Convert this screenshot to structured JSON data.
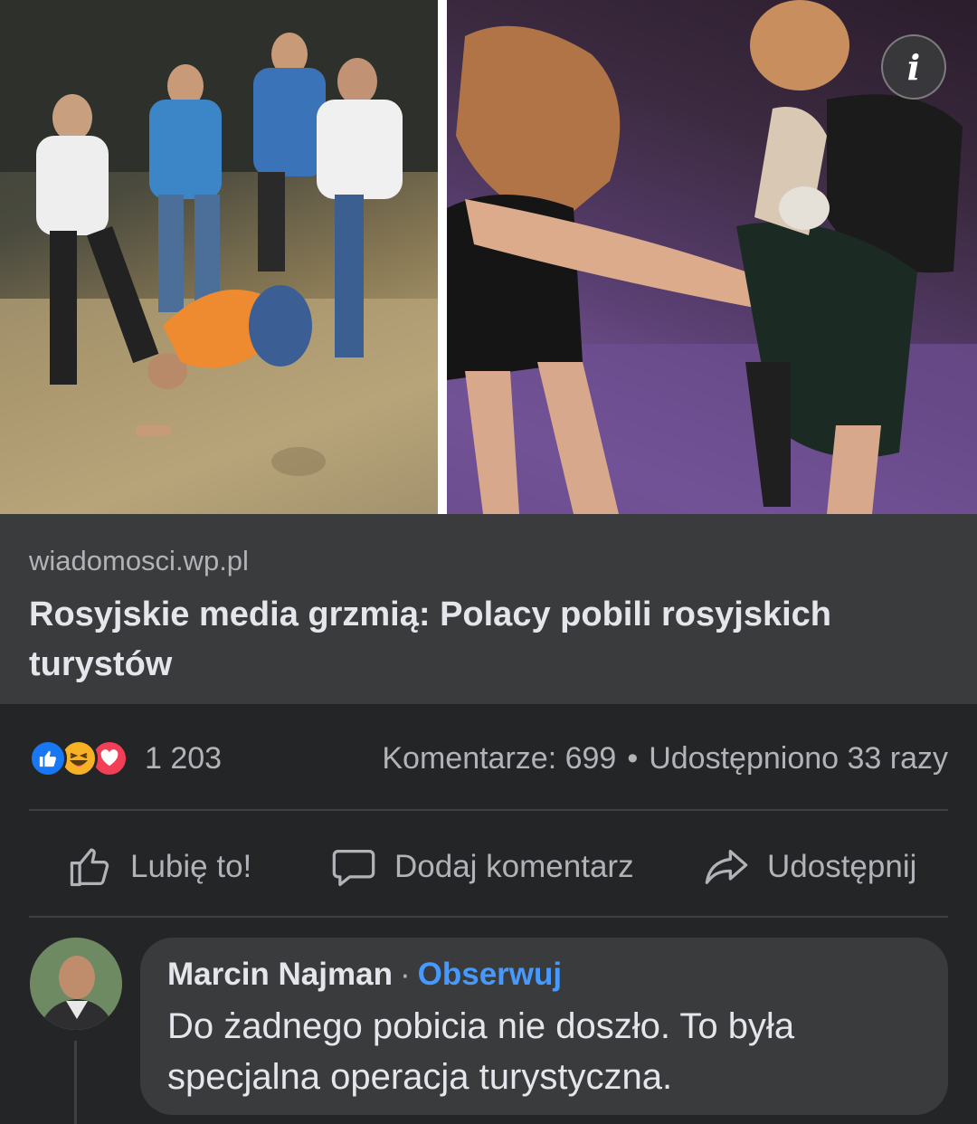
{
  "post": {
    "images": [
      {
        "alt": ""
      },
      {
        "alt": ""
      }
    ],
    "info_icon": "info-icon"
  },
  "link_preview": {
    "domain": "wiadomosci.wp.pl",
    "title": "Rosyjskie media grzmią: Polacy pobili rosyjskich turystów"
  },
  "stats": {
    "reactions": [
      "like-icon",
      "haha-icon",
      "love-icon"
    ],
    "reaction_count": "1 203",
    "comments": "Komentarze: 699",
    "separator": "•",
    "shares": "Udostępniono 33 razy"
  },
  "actions": {
    "like": "Lubię to!",
    "comment": "Dodaj komentarz",
    "share": "Udostępnij"
  },
  "comment": {
    "author": "Marcin Najman",
    "separator": "·",
    "follow": "Obserwuj",
    "text": "Do żadnego pobicia nie doszło. To była specjalna operacja turystyczna."
  },
  "colors": {
    "background": "#242526",
    "card": "#3a3b3c",
    "accent": "#4599ff",
    "like": "#1877f2",
    "love": "#f33e58",
    "haha": "#f7b125"
  }
}
